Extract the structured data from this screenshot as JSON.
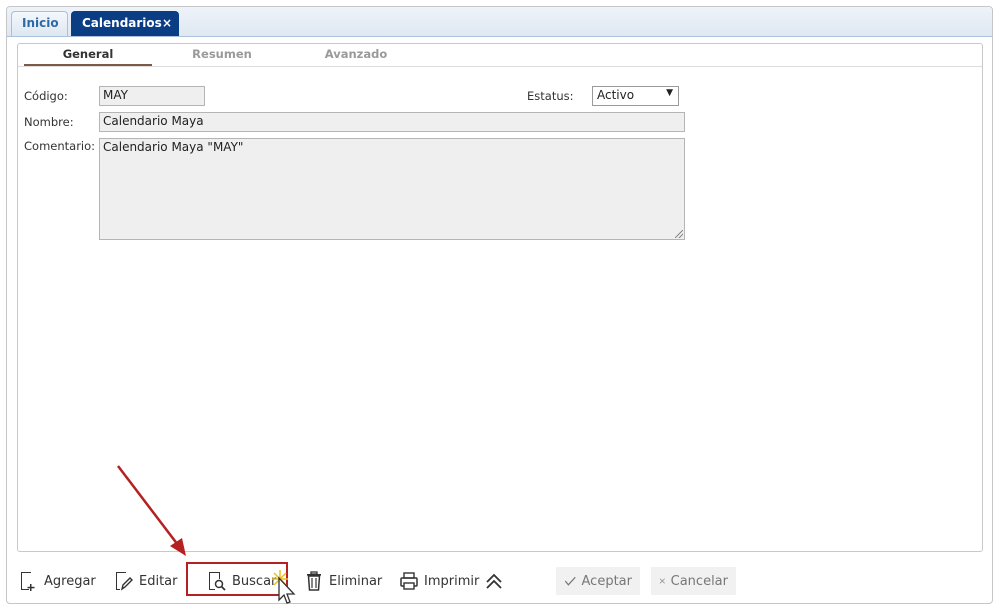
{
  "tabs": [
    {
      "label": "Inicio",
      "active": false
    },
    {
      "label": "Calendarios",
      "active": true,
      "close": "×"
    }
  ],
  "subtabs": [
    "General",
    "Resumen",
    "Avanzado"
  ],
  "form": {
    "codigo_label": "Código:",
    "codigo_value": "MAY",
    "estatus_label": "Estatus:",
    "estatus_value": "Activo",
    "nombre_label": "Nombre:",
    "nombre_value": "Calendario Maya",
    "comentario_label": "Comentario:",
    "comentario_value": "Calendario Maya \"MAY\""
  },
  "toolbar": {
    "agregar": "Agregar",
    "editar": "Editar",
    "buscar": "Buscar",
    "eliminar": "Eliminar",
    "imprimir": "Imprimir",
    "aceptar": "Aceptar",
    "cancelar": "Cancelar"
  },
  "colors": {
    "active_tab": "#0a3d84",
    "highlight": "#b52020",
    "annotation_arrow": "#b52020"
  }
}
